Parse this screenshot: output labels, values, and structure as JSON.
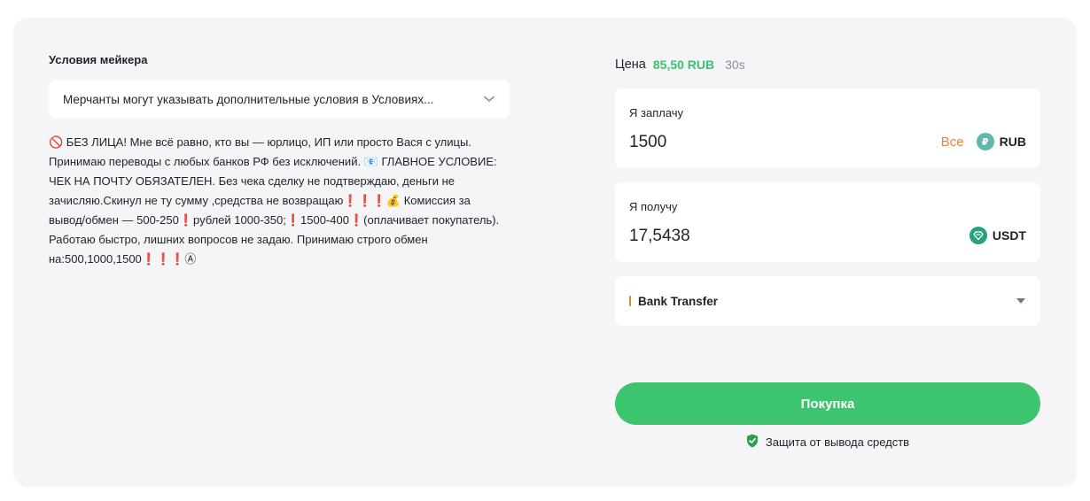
{
  "maker_terms": {
    "title": "Условия мейкера",
    "dropdown_text": "Мерчанты могут указывать дополнительные условия в Условиях...",
    "conditions_text": "🚫 БЕЗ ЛИЦА! Мне всё равно, кто вы — юрлицо, ИП или просто Вася с улицы. Принимаю переводы с любых банков РФ без исключений. 📧 ГЛАВНОЕ УСЛОВИЕ: ЧЕК НА ПОЧТУ ОБЯЗАТЕЛЕН. Без чека сделку не подтверждаю, деньги не зачисляю.Скинул не ту сумму ,средства не возвращаю❗❗❗💰 Комиссия за вывод/обмен — 500-250❗рублей 1000-350;❗1500-400❗(оплачивает покупатель). Работаю быстро, лишних вопросов не задаю. Принимаю строго обмен на:500,1000,1500❗❗❗Ⓐ"
  },
  "price": {
    "label": "Цена",
    "value": "85,50 RUB",
    "timer": "30s"
  },
  "pay": {
    "label": "Я заплачу",
    "amount": "1500",
    "all_label": "Все",
    "currency": "RUB",
    "coin_symbol": "₽",
    "coin_color": "#5fb8a9"
  },
  "receive": {
    "label": "Я получу",
    "amount": "17,5438",
    "currency": "USDT",
    "coin_symbol": "◆",
    "coin_color": "#26a17b"
  },
  "payment_method": {
    "label": "Bank Transfer",
    "accent_color": "#e8842c"
  },
  "buy_button": {
    "label": "Покупка",
    "color": "#3cc46e"
  },
  "protection": {
    "label": "Защита от вывода средств",
    "icon": "shield-check-icon",
    "color": "#2e9e4e"
  }
}
